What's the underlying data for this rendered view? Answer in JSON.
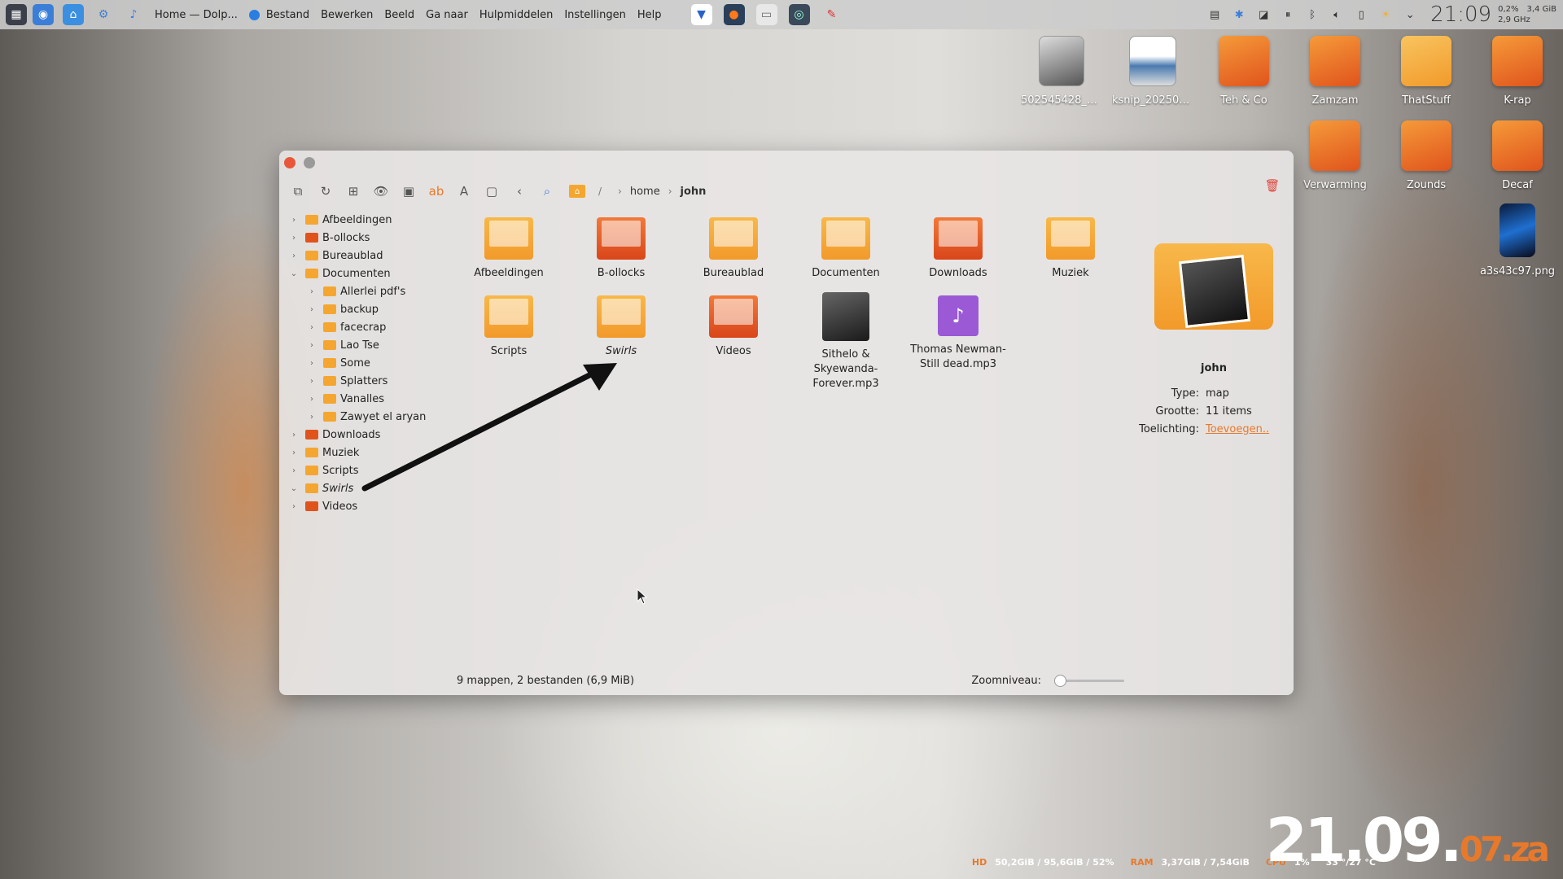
{
  "topbar": {
    "app_title": "Home — Dolp...",
    "menu": [
      "Bestand",
      "Bewerken",
      "Beeld",
      "Ga naar",
      "Hulpmiddelen",
      "Instellingen",
      "Help"
    ],
    "clock": "21:09",
    "sys": {
      "cpu_pct": "0,2%",
      "ram": "3,4 GiB",
      "freq": "2,9 GHz"
    }
  },
  "desktop": {
    "icons": [
      {
        "label": "502545428_72..."
      },
      {
        "label": "ksnip_202506..."
      },
      {
        "label": "Teh & Co"
      },
      {
        "label": "Zamzam"
      },
      {
        "label": "ThatStuff"
      },
      {
        "label": "K-rap"
      },
      {
        "label": "Verwarming"
      },
      {
        "label": "Zounds"
      },
      {
        "label": "Decaf"
      },
      {
        "label": "a3s43c97.png"
      }
    ]
  },
  "breadcrumb": {
    "root": "/",
    "home": "home",
    "current": "john"
  },
  "tree": [
    {
      "label": "Afbeeldingen",
      "level": 0,
      "open": false
    },
    {
      "label": "B-ollocks",
      "level": 0,
      "open": false
    },
    {
      "label": "Bureaublad",
      "level": 0,
      "open": false
    },
    {
      "label": "Documenten",
      "level": 0,
      "open": true
    },
    {
      "label": "Allerlei pdf's",
      "level": 1,
      "open": false
    },
    {
      "label": "backup",
      "level": 1,
      "open": false
    },
    {
      "label": "facecrap",
      "level": 1,
      "open": false
    },
    {
      "label": "Lao Tse",
      "level": 1,
      "open": false
    },
    {
      "label": "Some",
      "level": 1,
      "open": false
    },
    {
      "label": "Splatters",
      "level": 1,
      "open": false
    },
    {
      "label": "Vanalles",
      "level": 1,
      "open": false
    },
    {
      "label": "Zawyet el aryan",
      "level": 1,
      "open": false
    },
    {
      "label": "Downloads",
      "level": 0,
      "open": false
    },
    {
      "label": "Muziek",
      "level": 0,
      "open": false
    },
    {
      "label": "Scripts",
      "level": 0,
      "open": false
    },
    {
      "label": "Swirls",
      "level": 0,
      "open": true
    },
    {
      "label": "Videos",
      "level": 0,
      "open": false
    }
  ],
  "files": [
    {
      "label": "Afbeeldingen"
    },
    {
      "label": "B-ollocks"
    },
    {
      "label": "Bureaublad"
    },
    {
      "label": "Documenten"
    },
    {
      "label": "Downloads"
    },
    {
      "label": "Muziek"
    },
    {
      "label": "Scripts"
    },
    {
      "label": "Swirls"
    },
    {
      "label": "Videos"
    },
    {
      "label": "Sithelo & Skyewanda-Forever.mp3"
    },
    {
      "label": "Thomas Newman-Still dead.mp3"
    }
  ],
  "info": {
    "name": "john",
    "type_label": "Type:",
    "type_value": "map",
    "size_label": "Grootte:",
    "size_value": "11 items",
    "comment_label": "Toelichting:",
    "comment_value": "Toevoegen.."
  },
  "status": {
    "summary": "9 mappen, 2 bestanden (6,9 MiB)",
    "zoom_label": "Zoomniveau:",
    "zoom_level": 0
  },
  "bottom": {
    "hd_label": "HD",
    "hd_value": "50,2GiB / 95,6GiB / 52%",
    "ram_label": "RAM",
    "ram_value": "3,37GiB / 7,54GiB",
    "cpu_label": "CPU",
    "cpu_value": "1%",
    "temp_value": "33 °/27 °C",
    "date_main": "21.09.",
    "date_month": "07",
    "date_year": ".za"
  },
  "colors": {
    "accent": "#e8792b",
    "folder": "#f5a630"
  }
}
